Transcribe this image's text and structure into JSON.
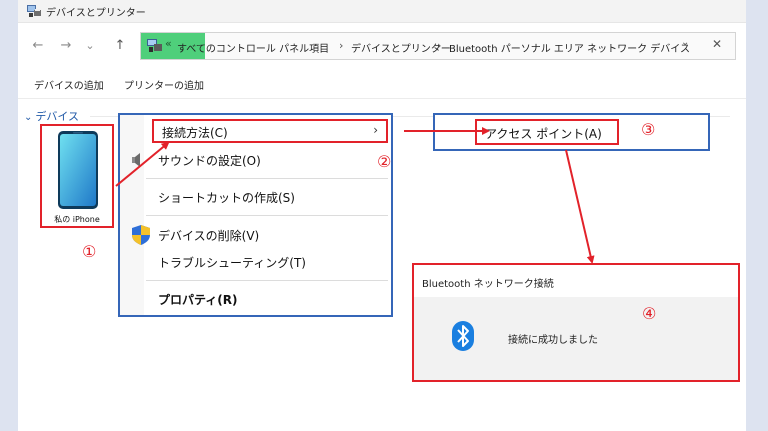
{
  "window": {
    "title": "デバイスとプリンター"
  },
  "address_bar": {
    "home_chevron": "«",
    "crumbs": [
      "すべてのコントロール パネル項目",
      "デバイスとプリンター",
      "Bluetooth パーソナル エリア ネットワーク デバイス"
    ],
    "separator": "›"
  },
  "toolbar": {
    "add_device": "デバイスの追加",
    "add_printer": "プリンターの追加"
  },
  "devices": {
    "group_label": "デバイス",
    "items": [
      {
        "label": "私の iPhone"
      }
    ]
  },
  "context_menu": {
    "items": [
      {
        "label": "接続方法(C)"
      },
      {
        "label": "サウンドの設定(O)"
      },
      {
        "label": "ショートカットの作成(S)"
      },
      {
        "label": "デバイスの削除(V)"
      },
      {
        "label": "トラブルシューティング(T)"
      },
      {
        "label": "プロパティ(R)"
      }
    ]
  },
  "submenu": {
    "item": "アクセス ポイント(A)"
  },
  "notification": {
    "title": "Bluetooth ネットワーク接続",
    "message": "接続に成功しました"
  },
  "step_numbers": [
    "①",
    "②",
    "③",
    "④"
  ],
  "colors": {
    "annotation_red": "#e2222a",
    "annotation_blue": "#3566b8",
    "address_highlight": "#4fcf7b",
    "bluetooth_blue": "#1a7fe0"
  },
  "icons": {
    "back": "←",
    "forward": "→",
    "recent": "⌄",
    "up": "↑",
    "dropdown": "⌄",
    "close": "✕",
    "submenu_arrow": "›"
  }
}
